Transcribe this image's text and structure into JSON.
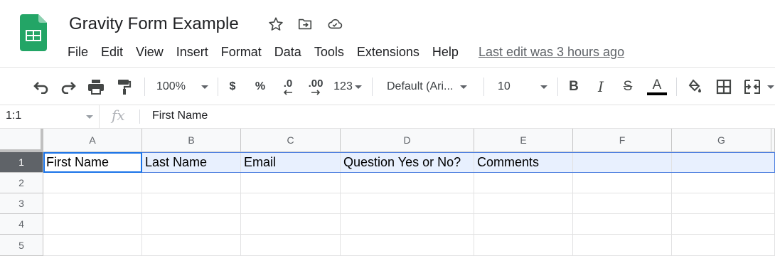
{
  "document": {
    "title": "Gravity Form Example",
    "last_edit": "Last edit was 3 hours ago"
  },
  "menu": [
    "File",
    "Edit",
    "View",
    "Insert",
    "Format",
    "Data",
    "Tools",
    "Extensions",
    "Help"
  ],
  "toolbar": {
    "zoom": "100%",
    "currency": "$",
    "percent": "%",
    "decrease_decimal": ".0",
    "increase_decimal": ".00",
    "number_format": "123",
    "font": "Default (Ari...",
    "font_size": "10",
    "bold": "B",
    "italic": "I",
    "strikethrough": "S",
    "text_color": "A"
  },
  "formula_bar": {
    "name_box": "1:1",
    "fx": "fx",
    "value": "First Name"
  },
  "grid": {
    "columns": [
      "A",
      "B",
      "C",
      "D",
      "E",
      "F",
      "G"
    ],
    "rows": [
      "1",
      "2",
      "3",
      "4",
      "5"
    ],
    "row1": [
      "First Name",
      "Last Name",
      "Email",
      "Question Yes or No?",
      "Comments",
      "",
      ""
    ]
  },
  "colors": {
    "sheets_green": "#0f9d58",
    "selection_blue": "#1a73e8",
    "row_highlight": "#e8f0fe"
  }
}
